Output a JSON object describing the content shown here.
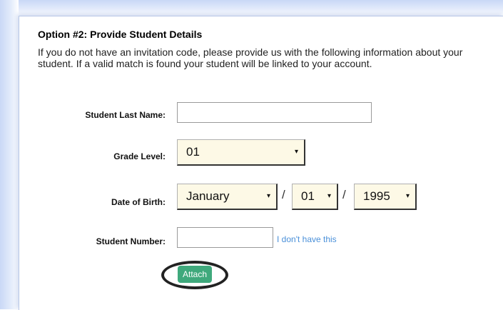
{
  "section": {
    "title": "Option #2: Provide Student Details",
    "description": "If you do not have an invitation code, please provide us with the following information about your student. If a valid match is found your student will be linked to your account."
  },
  "form": {
    "last_name_label": "Student Last Name:",
    "last_name_value": "",
    "grade_label": "Grade Level:",
    "grade_value": "01",
    "dob_label": "Date of Birth:",
    "dob_month": "January",
    "dob_day": "01",
    "dob_year": "1995",
    "dob_separator": "/",
    "student_number_label": "Student Number:",
    "student_number_value": "",
    "no_number_link": "I don't have this",
    "attach_label": "Attach"
  },
  "icons": {
    "dropdown_arrow": "▾"
  },
  "colors": {
    "attach_button": "#3fa97c",
    "link": "#4a90d9",
    "select_background": "#fdf9e6"
  }
}
